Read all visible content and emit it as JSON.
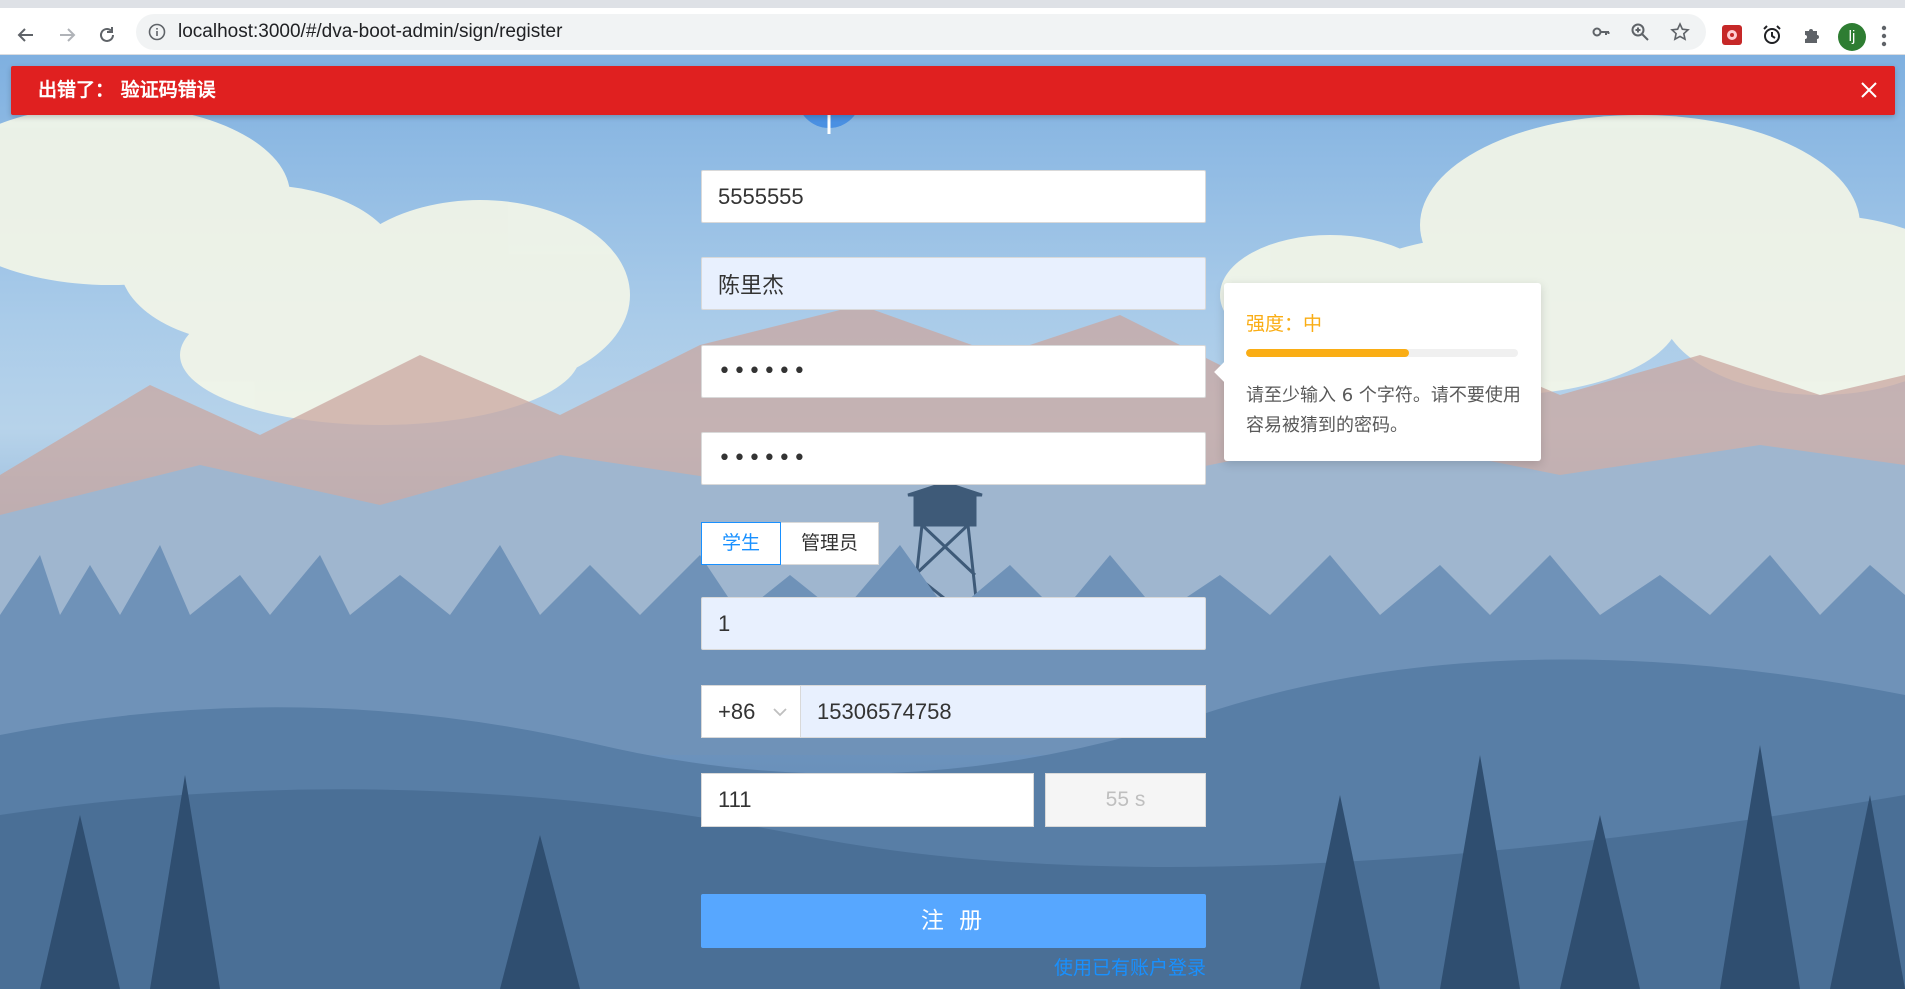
{
  "browser": {
    "url": "localhost:3000/#/dva-boot-admin/sign/register",
    "avatar_initial": "lj"
  },
  "alert": {
    "text": "出错了： 验证码错误"
  },
  "form": {
    "username_value": "5555555",
    "name_value": "陈里杰",
    "password_mask": "••••••",
    "confirm_mask": "••••••",
    "roles": [
      {
        "label": "学生",
        "selected": true
      },
      {
        "label": "管理员",
        "selected": false
      }
    ],
    "id_value": "1",
    "phone_prefix": "+86",
    "phone_value": "15306574758",
    "captcha_value": "111",
    "captcha_countdown": "55 s",
    "submit_label": "注 册",
    "login_link": "使用已有账户登录"
  },
  "strength_popover": {
    "label": "强度：中",
    "level_fraction": 0.6,
    "hint": "请至少输入 6 个字符。请不要使用容易被猜到的密码。",
    "color": "#faad14"
  },
  "colors": {
    "error": "#e02020",
    "primary": "#1890ff",
    "submit": "#57a7ff",
    "autofill": "#e8f0fe"
  }
}
